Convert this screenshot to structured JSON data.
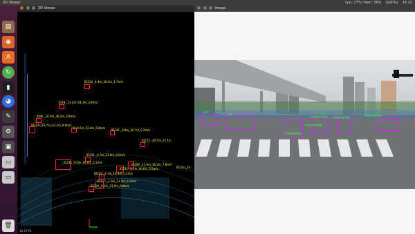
{
  "topbar": {
    "status_items": [
      "Lpu: 17% mem: 36%",
      "(100%)",
      "18:22"
    ]
  },
  "launcher": {
    "items": [
      "files-icon",
      "firefox-icon",
      "software-icon",
      "update-icon",
      "terminal-icon",
      "chrome-icon",
      "editor-icon",
      "settings-icon",
      "app-icon",
      "disk-icon",
      "disk-icon-2",
      "trash-icon"
    ]
  },
  "viewer": {
    "title": "3D Viewer",
    "footer": "18.6 FPS",
    "labels": [
      "ID218 _4.4m_38.4m_1.7m/s",
      "ID78 _13.4m_44.3m_2.9m/s",
      "ID86 _16.0m_36.2m_2.8m/s",
      "ID228 _20.7m_33.2m_6.8m/s",
      "ID_9.5m_32.4m_5.8m/s",
      "ID241 _0.8m_30.7m_0.2m/s",
      "ID225 _20.5m_27.1m",
      "ID231 _0.7m_21.8m_8.2m/s",
      "ID235 _6.0m_16.0m_5.1m/s",
      "ID209 _11.0m_16.2m_7.8m/s",
      "ID232 _3.7m_16.6m_5.5m/s",
      "ID212 _23",
      "ID232 _3.7m_16.6m_5.2m/s",
      "ID217 _2.3m_13.3m_6.2m/s",
      "ID219 _0.2m_11.9m_6.8m/s"
    ]
  },
  "image_window": {
    "title": "image",
    "detections": [
      "motorbike",
      "motorbike",
      "motorbike",
      "motorbike",
      "motorbike",
      "car",
      "car"
    ]
  },
  "colors": {
    "label_yellow": "#ffff33",
    "box_red": "#ff2020",
    "det_purple": "#d022ff",
    "det_green": "#33ff33",
    "launcher_bg": "#4a1f3a"
  }
}
